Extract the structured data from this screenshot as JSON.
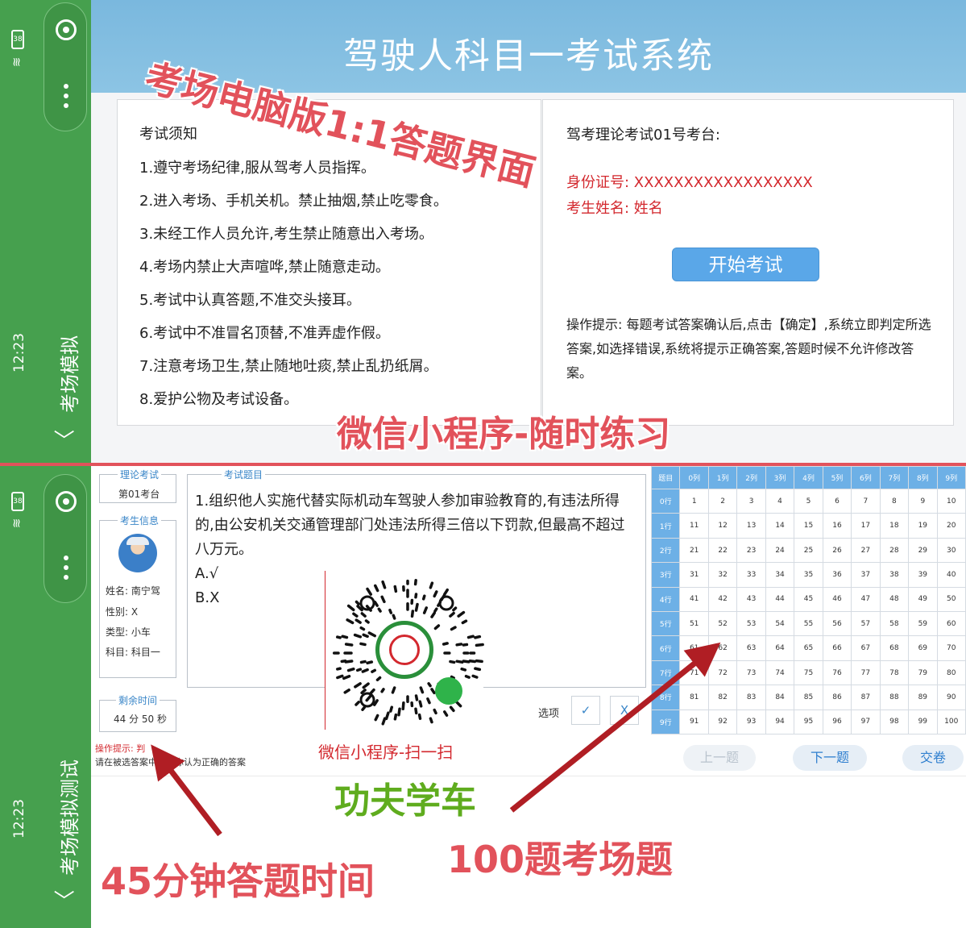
{
  "sidebar_top": {
    "title": "考场模拟",
    "time": "12:23",
    "battery": "38",
    "back_glyph": "〈"
  },
  "sidebar_bottom": {
    "title": "考场模拟测试",
    "time": "12:23",
    "battery": "38",
    "back_glyph": "〈"
  },
  "pc": {
    "title": "驾驶人科目一考试系统",
    "notice_title": "考试须知",
    "rules": [
      "1.遵守考场纪律,服从驾考人员指挥。",
      "2.进入考场、手机关机。禁止抽烟,禁止吃零食。",
      "3.未经工作人员允许,考生禁止随意出入考场。",
      "4.考场内禁止大声喧哗,禁止随意走动。",
      "5.考试中认真答题,不准交头接耳。",
      "6.考试中不准冒名顶替,不准弄虚作假。",
      "7.注意考场卫生,禁止随地吐痰,禁止乱扔纸屑。",
      "8.爱护公物及考试设备。"
    ],
    "seat_label": "驾考理论考试01号考台:",
    "id_line": "身份证号: XXXXXXXXXXXXXXXXXX",
    "name_line": "考生姓名: 姓名",
    "start_button": "开始考试",
    "tip": "操作提示: 每题考试答案确认后,点击【确定】,系统立即判定所选答案,如选择错误,系统将提示正确答案,答题时候不允许修改答案。"
  },
  "mini": {
    "exam_legend": "理论考试",
    "exam_seat": "第01考台",
    "info_legend": "考生信息",
    "info": [
      "姓名: 南宁驾",
      "性别: X",
      "类型: 小车",
      "科目: 科目一"
    ],
    "time_legend": "剩余时间",
    "time_value": "44 分 50 秒",
    "question_legend": "考试题目",
    "question": "1.组织他人实施代替实际机动车驾驶人参加审验教育的,有违法所得的,由公安机关交通管理部门处违法所得三倍以下罚款,但最高不超过八万元。",
    "option_a": "A.√",
    "option_b": "B.X",
    "options_label": "选项",
    "answer_true": "✓",
    "answer_false": "X",
    "op_tip": "操作提示: 判",
    "op_tip2": "请在被选答案中选择你认为正确的答案",
    "prev": "上一题",
    "next": "下一题",
    "submit": "交卷",
    "grid_corner": "题目",
    "grid_cols": [
      "0列",
      "1列",
      "2列",
      "3列",
      "4列",
      "5列",
      "6列",
      "7列",
      "8列",
      "9列"
    ],
    "grid_rows": [
      "0行",
      "1行",
      "2行",
      "3行",
      "4行",
      "5行",
      "6行",
      "7行",
      "8行",
      "9行"
    ]
  },
  "overlays": {
    "pc_version": "考场电脑版1:1答题界面",
    "wechat_practice": "微信小程序-随时练习",
    "wechat_scan": "微信小程序-扫一扫",
    "brand": "功夫学车",
    "time_note": "45分钟答题时间",
    "questions_note": "100题考场题"
  },
  "colors": {
    "sidebar": "#46a04e",
    "header": "#7ab8de",
    "accent_red": "#e2525b",
    "accent_green": "#5fac1e",
    "grid_header": "#6db0e6"
  }
}
